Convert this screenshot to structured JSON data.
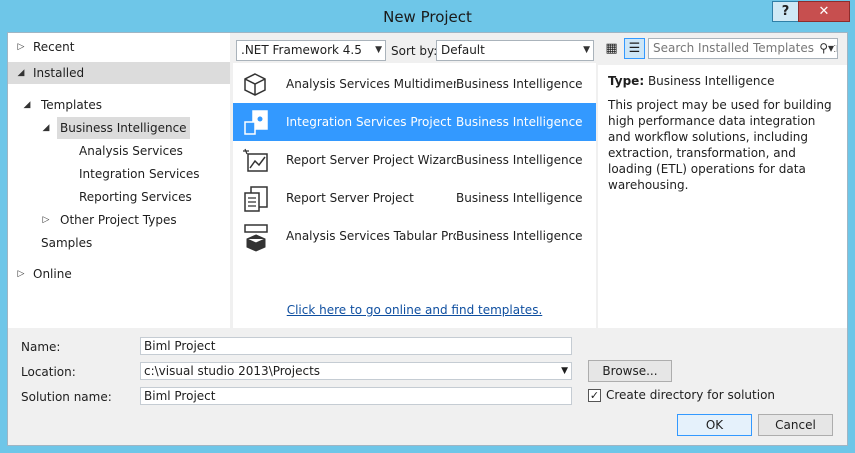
{
  "window": {
    "title": "New Project",
    "help_label": "?",
    "close_label": "✕"
  },
  "tree": {
    "recent": "Recent",
    "installed": "Installed",
    "templates": "Templates",
    "business_intelligence": "Business Intelligence",
    "analysis_services": "Analysis Services",
    "integration_services": "Integration Services",
    "reporting_services": "Reporting Services",
    "other_project_types": "Other Project Types",
    "samples": "Samples",
    "online": "Online"
  },
  "toolbar": {
    "framework": ".NET Framework 4.5",
    "sort_label": "Sort by:",
    "sort_value": "Default",
    "search_placeholder": "Search Installed Templates (Ctrl+E)"
  },
  "templates": [
    {
      "name": "Analysis Services Multidimensional and Data Mining Project",
      "category": "Business Intelligence",
      "icon": "cube-icon"
    },
    {
      "name": "Integration Services Project",
      "category": "Business Intelligence",
      "icon": "integration-icon"
    },
    {
      "name": "Report Server Project Wizard",
      "category": "Business Intelligence",
      "icon": "report-wizard-icon"
    },
    {
      "name": "Report Server Project",
      "category": "Business Intelligence",
      "icon": "report-icon"
    },
    {
      "name": "Analysis Services Tabular Project",
      "category": "Business Intelligence",
      "icon": "tabular-icon"
    }
  ],
  "online_link": "Click here to go online and find templates.",
  "description": {
    "type_label": "Type:",
    "type_value": "Business Intelligence",
    "text": "This project may be used for building high performance data integration and workflow solutions, including extraction, transformation, and loading (ETL) operations for data warehousing."
  },
  "form": {
    "name_label": "Name:",
    "name_value": "Biml Project",
    "location_label": "Location:",
    "location_value": "c:\\visual studio 2013\\Projects",
    "solution_label": "Solution name:",
    "solution_value": "Biml Project",
    "browse_label": "Browse...",
    "create_dir_label": "Create directory for solution",
    "ok_label": "OK",
    "cancel_label": "Cancel"
  }
}
